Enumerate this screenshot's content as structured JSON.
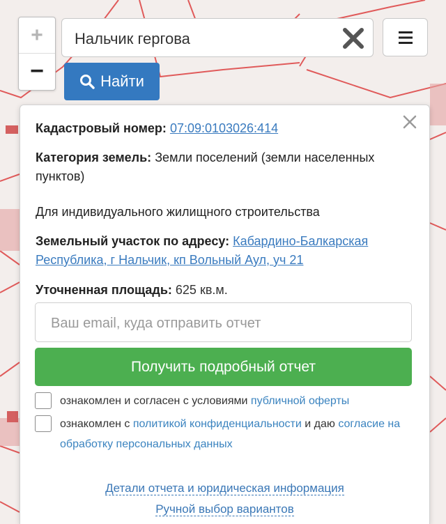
{
  "map": {
    "zoom_in": "+",
    "zoom_out": "−"
  },
  "search": {
    "value": "Нальчик гергова",
    "find_label": "Найти"
  },
  "popup": {
    "cadastral_label": "Кадастровый номер:",
    "cadastral_number": "07:09:0103026:414",
    "category_label": "Категория земель:",
    "category_value": "Земли поселений (земли населенных пунктов)",
    "usage": "Для индивидуального жилищного строительства",
    "address_label": "Земельный участок по адресу:",
    "address_value": "Кабардино-Балкарская Республика, г Нальчик, кп Вольный Аул, уч 21",
    "area_label": "Уточненная площадь:",
    "area_value": "625 кв.м.",
    "email_placeholder": "Ваш email, куда отправить отчет",
    "report_button": "Получить подробный отчет",
    "agree1_text": "ознакомлен и согласен с условиями",
    "agree1_link": "публичной оферты",
    "agree2_text_a": "ознакомлен с",
    "agree2_link_a": "политикой конфиденциальности",
    "agree2_text_b": "и даю",
    "agree2_link_b": "согласие на обработку персональных данных",
    "link_details": "Детали отчета и юридическая информация",
    "link_manual": "Ручной выбор вариантов"
  }
}
